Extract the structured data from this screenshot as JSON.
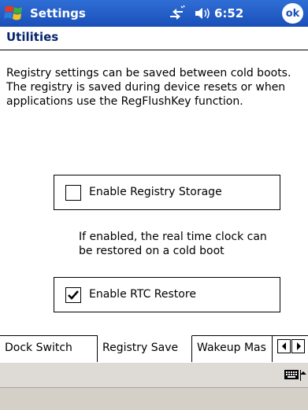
{
  "titlebar": {
    "app_name": "Settings",
    "time": "6:52",
    "ok_label": "ok"
  },
  "header": {
    "title": "Utilities"
  },
  "description": "Registry settings can be saved between cold boots. The registry is saved during device resets or when applications use the RegFlushKey function.",
  "options": {
    "registry_storage": {
      "label": "Enable Registry Storage",
      "checked": false
    },
    "rtc_restore": {
      "label": "Enable RTC Restore",
      "checked": true
    }
  },
  "note": "If enabled, the real time clock can be restored on a cold boot",
  "tabs": [
    {
      "label": "Dock Switch",
      "active": false
    },
    {
      "label": "Registry Save",
      "active": true
    },
    {
      "label": "Wakeup Mas",
      "active": false
    }
  ],
  "icons": {
    "start": "windows-flag-icon",
    "connectivity": "connectivity-icon",
    "volume": "speaker-icon",
    "keyboard": "keyboard-icon",
    "sip_arrow": "arrow-up-icon"
  },
  "colors": {
    "titlebar": "#1a4fb8",
    "header_text": "#08246b",
    "menubar": "#d4d0c8"
  }
}
